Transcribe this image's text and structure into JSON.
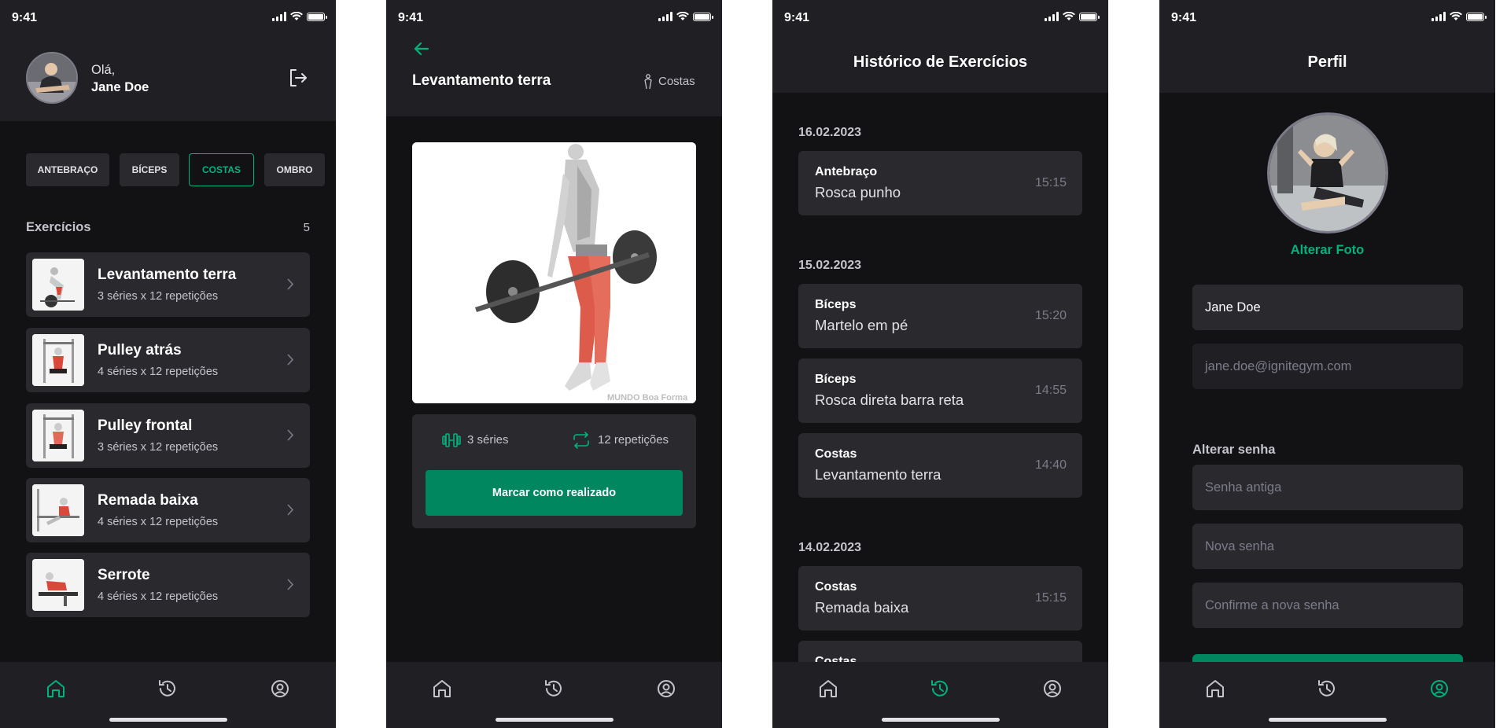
{
  "status_time": "9:41",
  "colors": {
    "bg": "#121214",
    "surface": "#202024",
    "card": "#29292e",
    "accent": "#00b37e",
    "button": "#00875f"
  },
  "home": {
    "greeting": "Olá,",
    "user_name": "Jane Doe",
    "groups": [
      "ANTEBRAÇO",
      "BÍCEPS",
      "COSTAS",
      "OMBRO"
    ],
    "active_group": "COSTAS",
    "section_title": "Exercícios",
    "count": "5",
    "exercises": [
      {
        "name": "Levantamento terra",
        "detail": "3 séries x 12 repetições"
      },
      {
        "name": "Pulley atrás",
        "detail": "4 séries x 12 repetições"
      },
      {
        "name": "Pulley frontal",
        "detail": "3 séries x 12 repetições"
      },
      {
        "name": "Remada baixa",
        "detail": "4 séries x 12 repetições"
      },
      {
        "name": "Serrote",
        "detail": "4 séries x 12 repetições"
      }
    ]
  },
  "exercise": {
    "title": "Levantamento terra",
    "group": "Costas",
    "series": "3 séries",
    "reps": "12 repetições",
    "button": "Marcar como realizado",
    "watermark": "MUNDO Boa Forma"
  },
  "history": {
    "title": "Histórico de Exercícios",
    "sections": [
      {
        "date": "16.02.2023",
        "items": [
          {
            "group": "Antebraço",
            "name": "Rosca punho",
            "time": "15:15"
          }
        ]
      },
      {
        "date": "15.02.2023",
        "items": [
          {
            "group": "Bíceps",
            "name": "Martelo em pé",
            "time": "15:20"
          },
          {
            "group": "Bíceps",
            "name": "Rosca direta barra reta",
            "time": "14:55"
          },
          {
            "group": "Costas",
            "name": "Levantamento terra",
            "time": "14:40"
          }
        ]
      },
      {
        "date": "14.02.2023",
        "items": [
          {
            "group": "Costas",
            "name": "Remada baixa",
            "time": "15:15"
          },
          {
            "group": "Costas",
            "name": "",
            "time": ""
          }
        ]
      }
    ]
  },
  "profile": {
    "title": "Perfil",
    "change_photo": "Alterar Foto",
    "name_value": "Jane Doe",
    "email_value": "jane.doe@ignitegym.com",
    "password_section": "Alterar senha",
    "old_password_placeholder": "Senha antiga",
    "new_password_placeholder": "Nova senha",
    "confirm_password_placeholder": "Confirme a nova senha"
  },
  "tabs": [
    "home-icon",
    "history-icon",
    "profile-icon"
  ]
}
